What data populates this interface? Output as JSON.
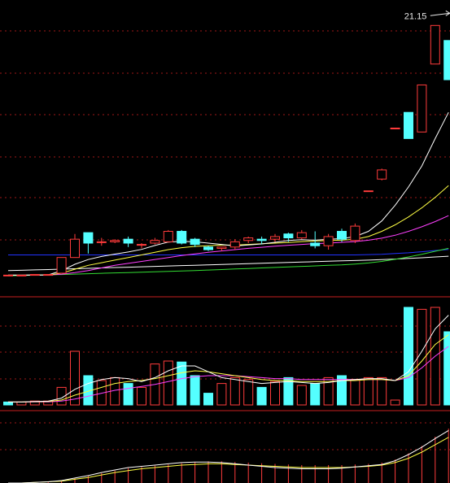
{
  "colors": {
    "background": "#000000",
    "up_candle": "#ff3b3b",
    "down_candle": "#54ffff",
    "grid": "#a01818",
    "divider": "#c82020",
    "ma_white": "#ffffff",
    "ma_yellow": "#ffff44",
    "ma_magenta": "#ff40ff",
    "ma_green": "#33dd33",
    "ma_blue": "#2233ff"
  },
  "chart_data": [
    {
      "type": "candlestick",
      "panel": "price",
      "ylim": [
        1.7,
        22.6
      ],
      "annotation": {
        "text": "21.15",
        "value": 21.15,
        "candle_index": 32
      },
      "candles": [
        {
          "o": 2.05,
          "c": 2.05,
          "h": 2.05,
          "l": 2.05
        },
        {
          "o": 2.05,
          "c": 2.05,
          "h": 2.05,
          "l": 2.05
        },
        {
          "o": 2.05,
          "c": 2.1,
          "h": 2.1,
          "l": 2.05
        },
        {
          "o": 2.1,
          "c": 2.1,
          "h": 2.1,
          "l": 2.1
        },
        {
          "o": 2.2,
          "c": 3.4,
          "h": 3.4,
          "l": 2.2
        },
        {
          "o": 3.4,
          "c": 4.8,
          "h": 5.2,
          "l": 3.4
        },
        {
          "o": 5.3,
          "c": 4.5,
          "h": 5.3,
          "l": 3.7
        },
        {
          "o": 4.6,
          "c": 4.6,
          "h": 4.9,
          "l": 4.3
        },
        {
          "o": 4.6,
          "c": 4.7,
          "h": 4.8,
          "l": 4.5
        },
        {
          "o": 4.8,
          "c": 4.5,
          "h": 5.0,
          "l": 4.2
        },
        {
          "o": 4.4,
          "c": 4.4,
          "h": 4.5,
          "l": 4.1
        },
        {
          "o": 4.5,
          "c": 4.7,
          "h": 4.9,
          "l": 4.4
        },
        {
          "o": 4.6,
          "c": 5.4,
          "h": 5.5,
          "l": 4.6
        },
        {
          "o": 5.4,
          "c": 4.5,
          "h": 5.5,
          "l": 4.4
        },
        {
          "o": 4.8,
          "c": 4.4,
          "h": 4.9,
          "l": 4.2
        },
        {
          "o": 4.2,
          "c": 4.0,
          "h": 4.3,
          "l": 3.9
        },
        {
          "o": 4.1,
          "c": 4.2,
          "h": 4.2,
          "l": 3.9
        },
        {
          "o": 4.2,
          "c": 4.6,
          "h": 4.8,
          "l": 4.0
        },
        {
          "o": 4.7,
          "c": 4.9,
          "h": 5.0,
          "l": 4.5
        },
        {
          "o": 4.8,
          "c": 4.7,
          "h": 5.0,
          "l": 4.4
        },
        {
          "o": 4.8,
          "c": 5.0,
          "h": 5.2,
          "l": 4.6
        },
        {
          "o": 5.2,
          "c": 4.9,
          "h": 5.3,
          "l": 4.6
        },
        {
          "o": 4.9,
          "c": 5.3,
          "h": 5.5,
          "l": 4.8
        },
        {
          "o": 4.5,
          "c": 4.3,
          "h": 5.4,
          "l": 4.1
        },
        {
          "o": 4.3,
          "c": 5.0,
          "h": 5.2,
          "l": 4.0
        },
        {
          "o": 5.4,
          "c": 4.8,
          "h": 5.6,
          "l": 4.6
        },
        {
          "o": 4.7,
          "c": 5.8,
          "h": 6.0,
          "l": 4.5
        },
        {
          "o": 8.5,
          "c": 8.5,
          "h": 8.5,
          "l": 8.5
        },
        {
          "o": 9.4,
          "c": 10.1,
          "h": 10.2,
          "l": 9.3
        },
        {
          "o": 13.3,
          "c": 13.3,
          "h": 13.3,
          "l": 13.3
        },
        {
          "o": 14.5,
          "c": 12.5,
          "h": 14.5,
          "l": 12.5
        },
        {
          "o": 13.0,
          "c": 16.6,
          "h": 16.6,
          "l": 13.0
        },
        {
          "o": 18.2,
          "c": 21.15,
          "h": 21.15,
          "l": 18.2
        },
        {
          "o": 20.0,
          "c": 17.0,
          "h": 20.0,
          "l": 17.0
        }
      ],
      "ma_white": [
        2.05,
        2.05,
        2.06,
        2.07,
        2.39,
        2.88,
        3.24,
        3.48,
        3.66,
        3.82,
        4.02,
        4.32,
        4.58,
        4.64,
        4.6,
        4.5,
        4.4,
        4.28,
        4.36,
        4.44,
        4.56,
        4.7,
        4.76,
        4.72,
        4.8,
        4.84,
        5.0,
        5.4,
        6.2,
        7.4,
        8.8,
        10.4,
        12.5,
        14.5
      ],
      "ma_yellow": [
        2.05,
        2.05,
        2.06,
        2.07,
        2.2,
        2.5,
        2.8,
        3.0,
        3.2,
        3.4,
        3.6,
        3.8,
        4.0,
        4.15,
        4.25,
        4.3,
        4.35,
        4.35,
        4.4,
        4.45,
        4.5,
        4.55,
        4.62,
        4.66,
        4.7,
        4.72,
        4.8,
        5.0,
        5.4,
        5.9,
        6.5,
        7.2,
        8.0,
        8.9
      ],
      "ma_magenta": [
        2.05,
        2.05,
        2.06,
        2.07,
        2.12,
        2.25,
        2.4,
        2.6,
        2.8,
        2.95,
        3.1,
        3.25,
        3.4,
        3.55,
        3.68,
        3.8,
        3.9,
        4.0,
        4.1,
        4.18,
        4.26,
        4.34,
        4.4,
        4.46,
        4.5,
        4.56,
        4.62,
        4.72,
        4.88,
        5.1,
        5.4,
        5.75,
        6.15,
        6.6
      ],
      "ma_green": [
        2.0,
        2.02,
        2.05,
        2.08,
        2.1,
        2.13,
        2.16,
        2.19,
        2.22,
        2.25,
        2.28,
        2.31,
        2.34,
        2.37,
        2.4,
        2.44,
        2.48,
        2.52,
        2.56,
        2.6,
        2.64,
        2.68,
        2.72,
        2.76,
        2.8,
        2.84,
        2.9,
        2.98,
        3.1,
        3.26,
        3.44,
        3.65,
        3.88,
        4.1
      ],
      "ma_blue": [
        3.6,
        3.6,
        3.6,
        3.6,
        3.6,
        3.6,
        3.6,
        3.6,
        3.6,
        3.6,
        3.6,
        3.6,
        3.6,
        3.6,
        3.6,
        3.6,
        3.6,
        3.6,
        3.6,
        3.6,
        3.6,
        3.6,
        3.6,
        3.6,
        3.6,
        3.6,
        3.6,
        3.62,
        3.65,
        3.7,
        3.76,
        3.84,
        3.93,
        4.02
      ],
      "ma_base": [
        2.4,
        2.42,
        2.45,
        2.48,
        2.51,
        2.54,
        2.57,
        2.6,
        2.63,
        2.66,
        2.69,
        2.72,
        2.75,
        2.78,
        2.81,
        2.84,
        2.87,
        2.9,
        2.93,
        2.96,
        2.99,
        3.02,
        3.05,
        3.08,
        3.11,
        3.14,
        3.17,
        3.2,
        3.24,
        3.28,
        3.33,
        3.38,
        3.44,
        3.5
      ]
    },
    {
      "type": "bar",
      "panel": "volume",
      "ylim": [
        0,
        100
      ],
      "values": [
        3,
        3,
        4,
        4,
        18,
        55,
        30,
        25,
        28,
        22,
        18,
        42,
        45,
        44,
        30,
        12,
        22,
        28,
        26,
        18,
        24,
        28,
        20,
        22,
        28,
        30,
        26,
        28,
        28,
        5,
        100,
        98,
        100,
        75
      ],
      "directions": [
        "down",
        "up",
        "up",
        "up",
        "up",
        "up",
        "down",
        "up",
        "up",
        "down",
        "up",
        "up",
        "up",
        "down",
        "down",
        "down",
        "up",
        "up",
        "up",
        "down",
        "up",
        "down",
        "up",
        "down",
        "up",
        "down",
        "up",
        "up",
        "up",
        "up",
        "down",
        "up",
        "up",
        "down"
      ],
      "ma_white": [
        3,
        3,
        3.5,
        3.8,
        7,
        16,
        22,
        26,
        28,
        27,
        24,
        28,
        35,
        40,
        40,
        34,
        28,
        26,
        24,
        22,
        23,
        24,
        23,
        22,
        23,
        25,
        26,
        27,
        27,
        25,
        34,
        55,
        78,
        92
      ],
      "ma_yellow": [
        3,
        3,
        3.3,
        3.5,
        5,
        10,
        14,
        18,
        22,
        24,
        25,
        27,
        30,
        33,
        35,
        34,
        32,
        30,
        28,
        26,
        25,
        25,
        24,
        24,
        24,
        25,
        25,
        26,
        26,
        25,
        30,
        45,
        62,
        72
      ],
      "ma_magenta": [
        3,
        3,
        3.1,
        3.2,
        4,
        6,
        9,
        12,
        15,
        17,
        19,
        21,
        24,
        27,
        29,
        30,
        30,
        30,
        29,
        28,
        27,
        27,
        26,
        26,
        26,
        26,
        26,
        26,
        26,
        25,
        28,
        38,
        50,
        60
      ]
    },
    {
      "type": "bar",
      "panel": "indicator",
      "ylim": [
        0,
        100
      ],
      "values": [
        0,
        0,
        0,
        2,
        4,
        8,
        12,
        16,
        20,
        24,
        26,
        28,
        30,
        32,
        34,
        35,
        35,
        34,
        33,
        32,
        31,
        30,
        29,
        29,
        29,
        29,
        30,
        31,
        33,
        38,
        48,
        60,
        75,
        88
      ],
      "line_white": [
        0,
        0,
        1,
        2,
        4,
        8,
        12,
        17,
        21,
        25,
        27,
        29,
        31,
        33,
        34,
        34,
        33,
        31,
        29,
        27,
        25,
        24,
        23,
        23,
        23,
        24,
        26,
        28,
        30,
        36,
        46,
        58,
        72,
        85
      ],
      "line_yellow": [
        0,
        0,
        1,
        2,
        3,
        6,
        9,
        13,
        17,
        20,
        23,
        25,
        27,
        29,
        30,
        31,
        31,
        30,
        29,
        28,
        27,
        26,
        25,
        25,
        25,
        25,
        26,
        27,
        29,
        33,
        40,
        50,
        62,
        74
      ]
    }
  ]
}
